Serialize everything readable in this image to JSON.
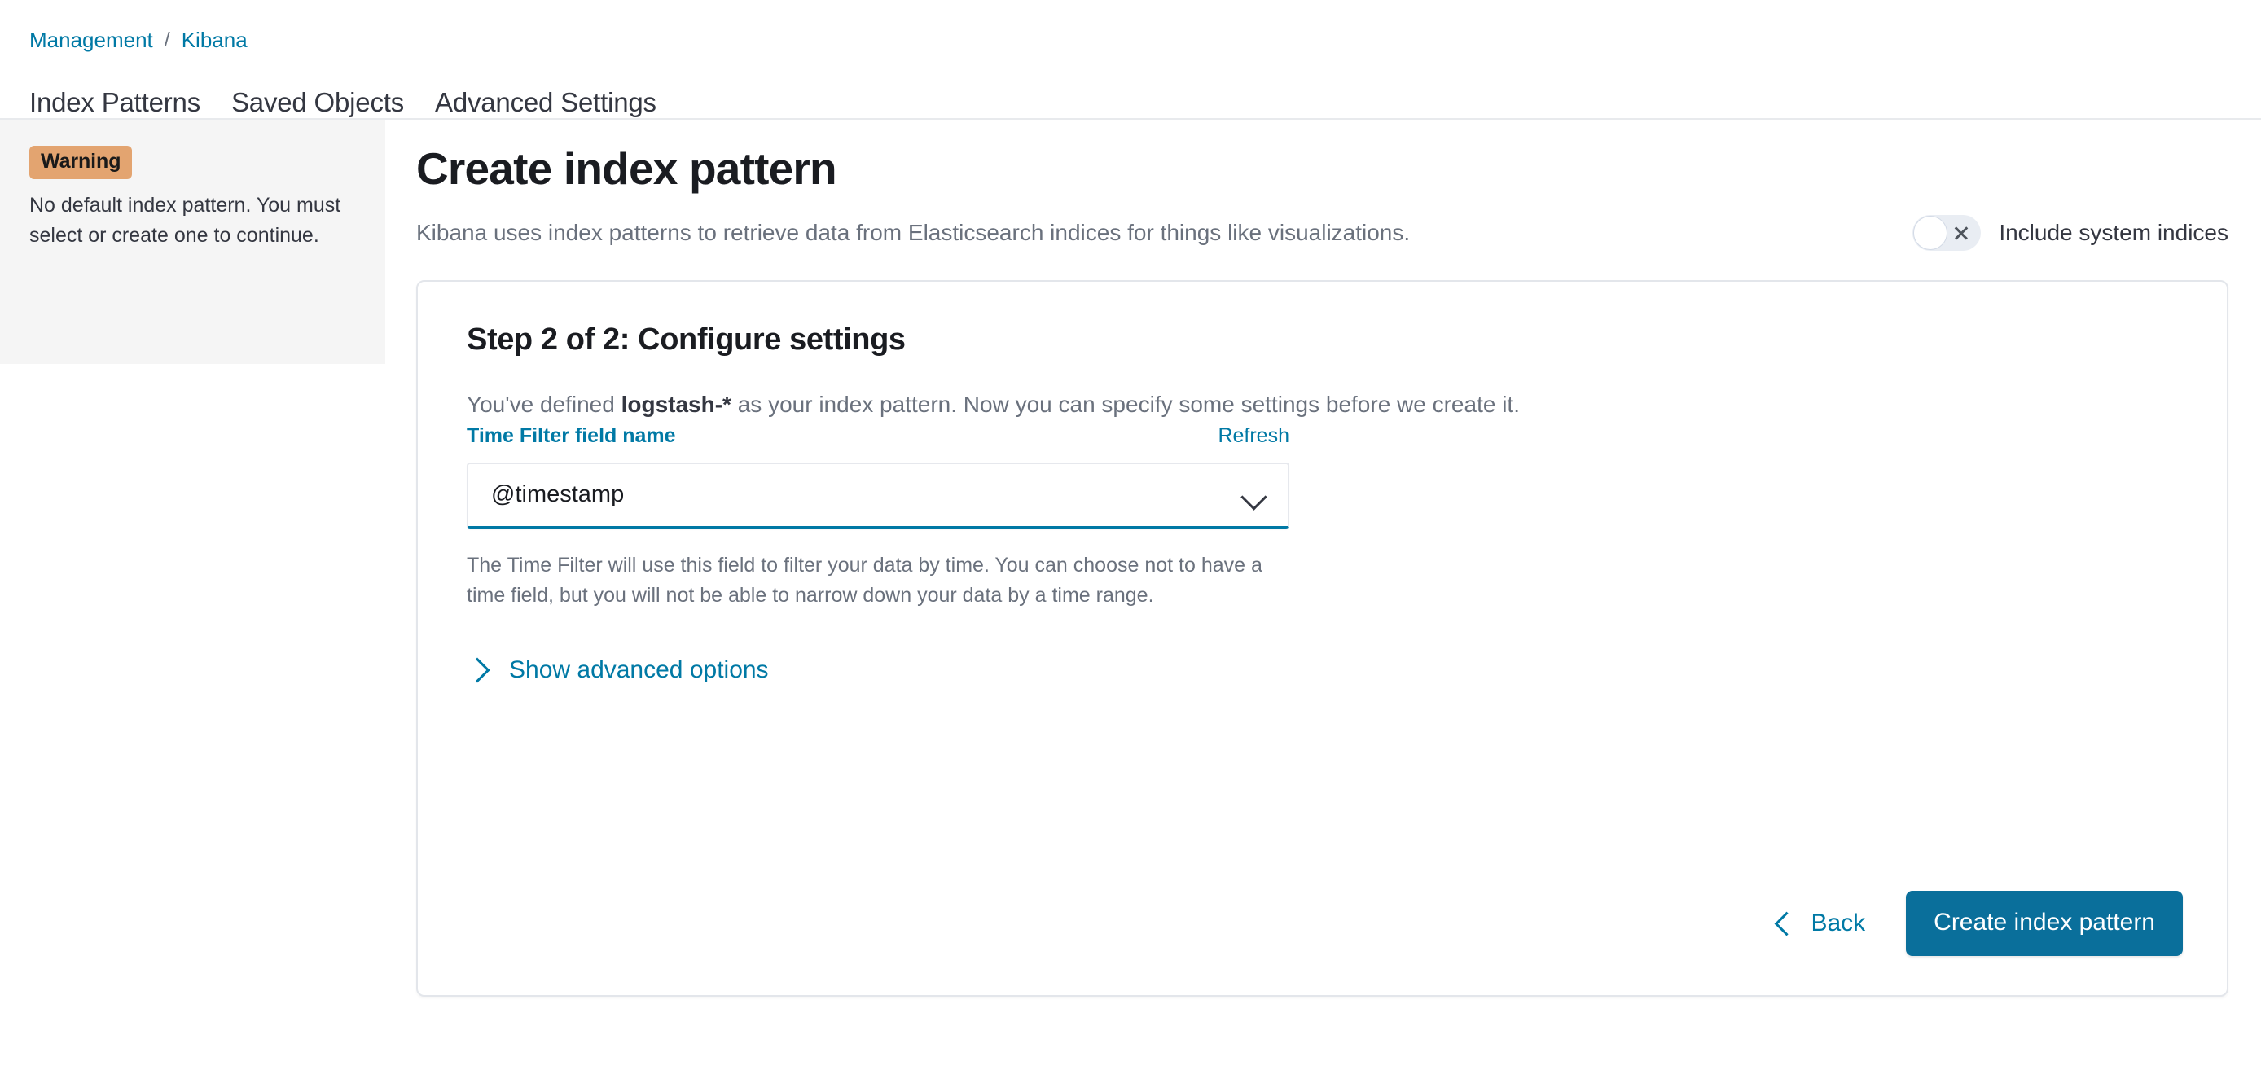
{
  "breadcrumb": {
    "items": [
      {
        "label": "Management"
      },
      {
        "label": "Kibana"
      }
    ],
    "separator": "/"
  },
  "tabs": [
    {
      "label": "Index Patterns"
    },
    {
      "label": "Saved Objects"
    },
    {
      "label": "Advanced Settings"
    }
  ],
  "sidebar": {
    "warning_badge": "Warning",
    "warning_text": "No default index pattern. You must select or create one to continue."
  },
  "header": {
    "title": "Create index pattern",
    "subtitle": "Kibana uses index patterns to retrieve data from Elasticsearch indices for things like visualizations.",
    "system_indices_toggle": {
      "label": "Include system indices",
      "state": "off",
      "icon": "close-x-icon"
    }
  },
  "panel": {
    "step_title": "Step 2 of 2: Configure settings",
    "description": {
      "prefix": "You've defined ",
      "pattern": "logstash-*",
      "suffix": " as your index pattern. Now you can specify some settings before we create it."
    },
    "field": {
      "label": "Time Filter field name",
      "refresh_label": "Refresh",
      "selected_value": "@timestamp",
      "dropdown_icon": "chevron-down-icon"
    },
    "help_text": "The Time Filter will use this field to filter your data by time. You can choose not to have a time field, but you will not be able to narrow down your data by a time range.",
    "advanced": {
      "label": "Show advanced options",
      "icon": "chevron-right-icon"
    },
    "footer": {
      "back_label": "Back",
      "back_icon": "chevron-left-icon",
      "create_label": "Create index pattern"
    }
  },
  "colors": {
    "link": "#0079a5",
    "primary_button": "#0a6f9b",
    "warning_badge": "#e3a470",
    "sidebar_bg": "#f5f5f5",
    "muted_text": "#6a717d"
  }
}
